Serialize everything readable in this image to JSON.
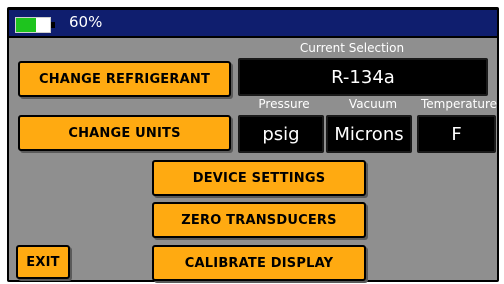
{
  "status": {
    "battery_percent_text": "60%",
    "battery_level": 0.6
  },
  "labels": {
    "current_selection": "Current Selection",
    "pressure": "Pressure",
    "vacuum": "Vacuum",
    "temperature": "Temperature"
  },
  "values": {
    "refrigerant": "R-134a",
    "pressure_unit": "psig",
    "vacuum_unit": "Microns",
    "temperature_unit": "F"
  },
  "buttons": {
    "change_refrigerant": "CHANGE REFRIGERANT",
    "change_units": "CHANGE UNITS",
    "device_settings": "DEVICE SETTINGS",
    "zero_transducers": "ZERO TRANSDUCERS",
    "exit": "EXIT",
    "calibrate_display": "CALIBRATE DISPLAY"
  },
  "colors": {
    "status_bar": "#0f1e6e",
    "panel": "#8f8f8f",
    "button": "#ffaa11",
    "battery_fill": "#1ec41e"
  }
}
